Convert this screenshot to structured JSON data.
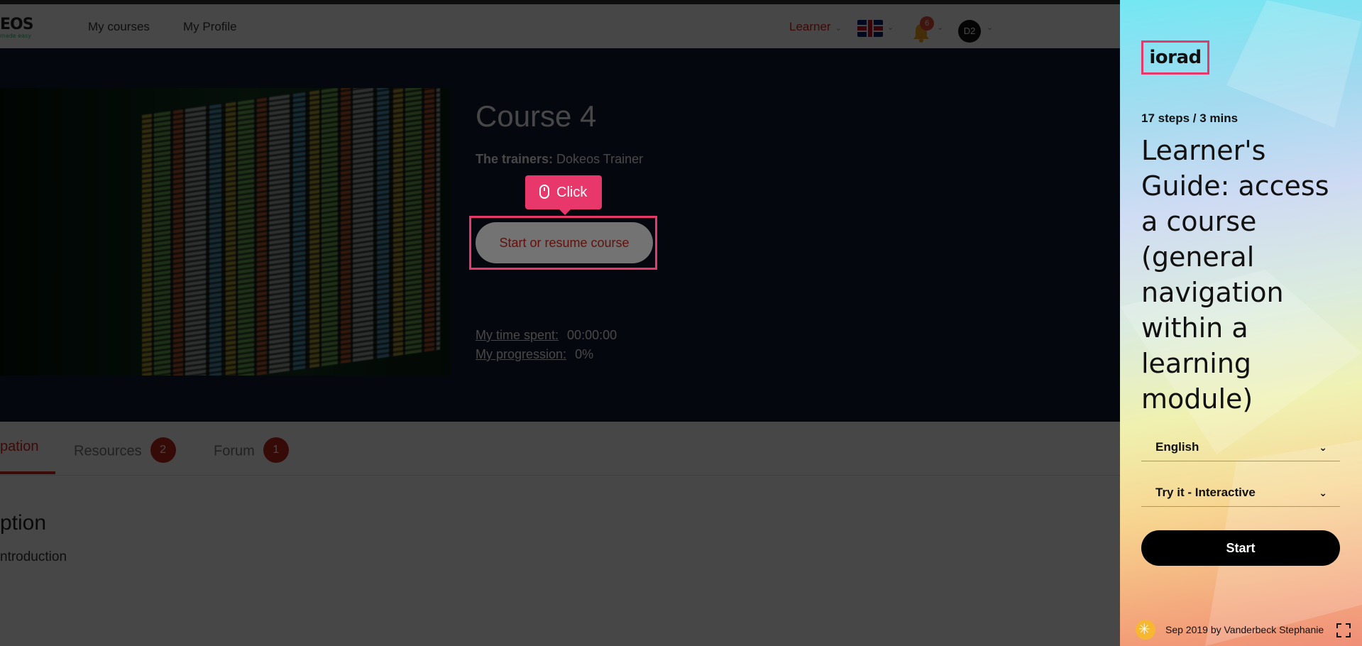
{
  "header": {
    "logo_text": "EOS",
    "logo_tagline": "made easy",
    "nav": [
      {
        "label": "My courses"
      },
      {
        "label": "My Profile"
      }
    ],
    "role": "Learner",
    "notification_count": "6",
    "avatar_initials": "D2"
  },
  "course": {
    "title": "Course 4",
    "trainers_label": "The trainers:",
    "trainers_value": "Dokeos Trainer",
    "tooltip": "Click",
    "start_button": "Start or resume course",
    "time_spent_label": "My time spent:",
    "time_spent_value": "00:00:00",
    "progression_label": "My progression:",
    "progression_value": "0%"
  },
  "tabs": [
    {
      "label": "pation",
      "active": true
    },
    {
      "label": "Resources",
      "badge": "2"
    },
    {
      "label": "Forum",
      "badge": "1"
    }
  ],
  "section": {
    "title": "ption",
    "item": "ntroduction"
  },
  "panel": {
    "logo": "iorad",
    "steps": "17 steps / 3 mins",
    "title": "Learner's Guide: access a course (general navigation within a learning module)",
    "language": "English",
    "mode": "Try it - Interactive",
    "start_button": "Start",
    "footer": "Sep 2019 by Vanderbeck Stephanie"
  },
  "colors": {
    "accent": "#e8376a",
    "brand_red": "#d9261c",
    "hero_bg": "#0f1a33"
  }
}
